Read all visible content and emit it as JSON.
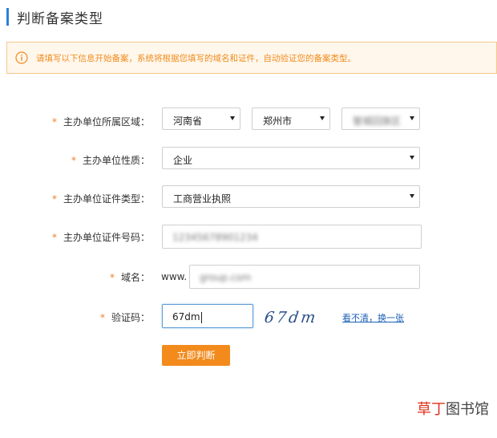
{
  "page": {
    "title": "判断备案类型"
  },
  "notice": {
    "text": "请填写以下信息开始备案，系统将根据您填写的域名和证件，自动验证您的备案类型。"
  },
  "form": {
    "required_mark": "*",
    "region": {
      "label": "主办单位所属区域：",
      "province": "河南省",
      "city": "郑州市",
      "district": "管城回族区"
    },
    "nature": {
      "label": "主办单位性质：",
      "value": "企业"
    },
    "cert_type": {
      "label": "主办单位证件类型：",
      "value": "工商营业执照"
    },
    "cert_number": {
      "label": "主办单位证件号码：",
      "value": "12345678901234"
    },
    "domain": {
      "label": "域名：",
      "prefix": "www.",
      "value": "group.com"
    },
    "captcha": {
      "label": "验证码：",
      "value": "67dm",
      "image_text": "67dm",
      "refresh_label": "看不清，换一张"
    },
    "submit_label": "立即判断"
  },
  "watermark": {
    "part1": "草丁",
    "part2": "图书馆"
  },
  "colors": {
    "accent": "#2f7fd8",
    "orange": "#f28a1c",
    "notice_bg": "#fff7ec",
    "link": "#1a5fb4"
  }
}
